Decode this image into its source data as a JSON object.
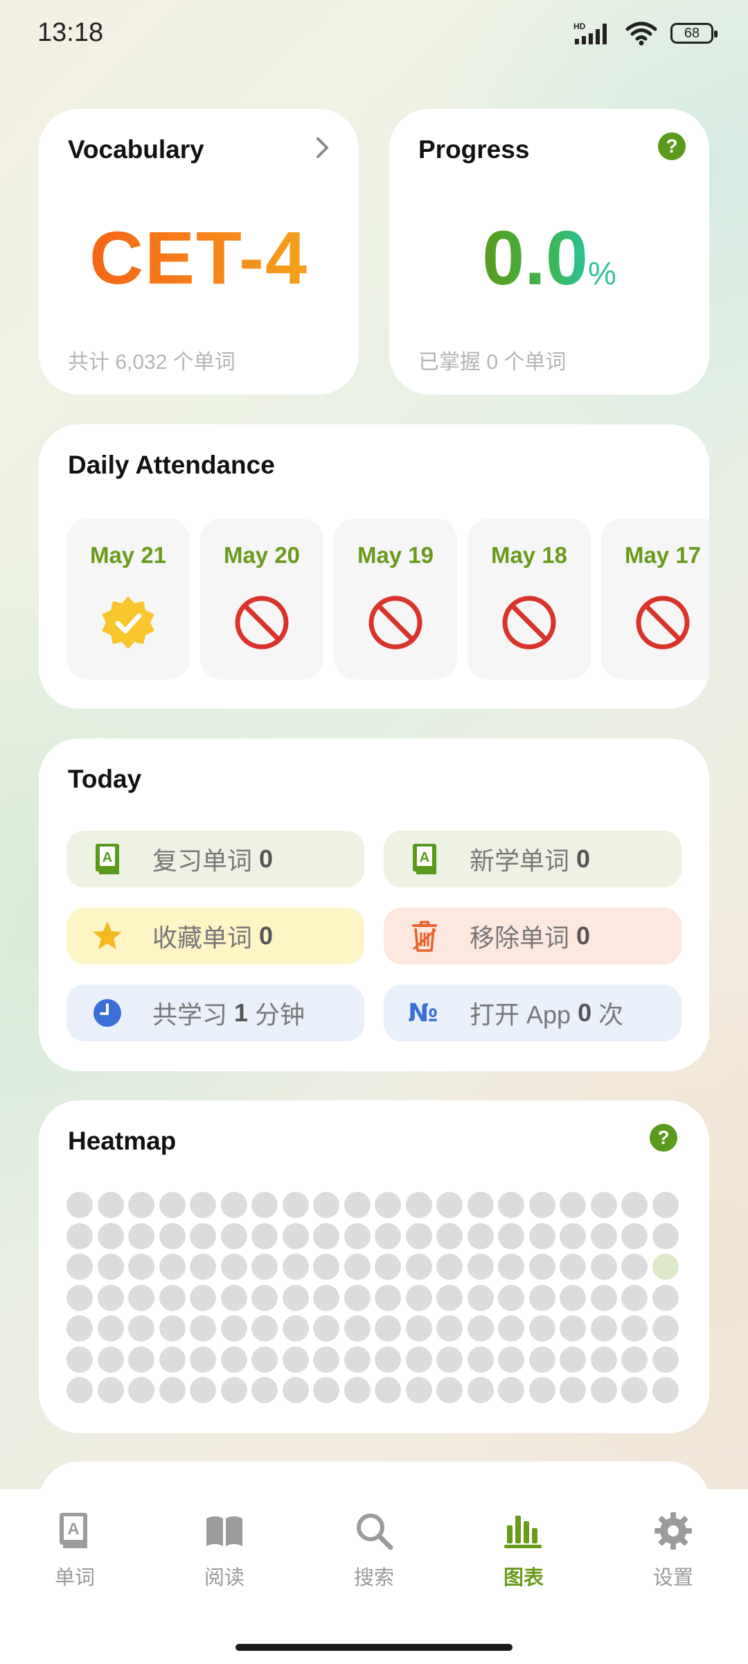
{
  "status_bar": {
    "time": "13:18",
    "battery": "68",
    "network": "HD"
  },
  "vocabulary": {
    "title": "Vocabulary",
    "book": "CET-4",
    "footer": "共计 6,032 个单词"
  },
  "progress": {
    "title": "Progress",
    "value": "0.0",
    "unit": "%",
    "footer": "已掌握 0 个单词"
  },
  "attendance": {
    "title": "Daily Attendance",
    "days": [
      {
        "date": "May 21",
        "status": "checked"
      },
      {
        "date": "May 20",
        "status": "missed"
      },
      {
        "date": "May 19",
        "status": "missed"
      },
      {
        "date": "May 18",
        "status": "missed"
      },
      {
        "date": "May 17",
        "status": "missed"
      }
    ]
  },
  "today": {
    "title": "Today",
    "stats": {
      "review": {
        "label": "复习单词",
        "count": "0"
      },
      "new": {
        "label": "新学单词",
        "count": "0"
      },
      "favorite": {
        "label": "收藏单词",
        "count": "0"
      },
      "removed": {
        "label": "移除单词",
        "count": "0"
      },
      "study_time": {
        "label": "共学习",
        "count": "1",
        "unit": "分钟"
      },
      "app_open": {
        "label": "打开 App",
        "count": "0",
        "unit": "次"
      }
    }
  },
  "heatmap": {
    "title": "Heatmap",
    "rows": 7,
    "cols": 20,
    "active_cells": [
      [
        2,
        19
      ]
    ]
  },
  "nav": {
    "items": [
      {
        "label": "单词",
        "icon": "word-book-icon"
      },
      {
        "label": "阅读",
        "icon": "open-book-icon"
      },
      {
        "label": "搜索",
        "icon": "search-icon"
      },
      {
        "label": "图表",
        "icon": "chart-icon"
      },
      {
        "label": "设置",
        "icon": "gear-icon"
      }
    ],
    "active": "图表"
  },
  "colors": {
    "accent": "#6a9a1c",
    "cet_gradient_start": "#f35a15",
    "cet_gradient_end": "#f5b21e",
    "progress_green": "#5a9a1c"
  }
}
